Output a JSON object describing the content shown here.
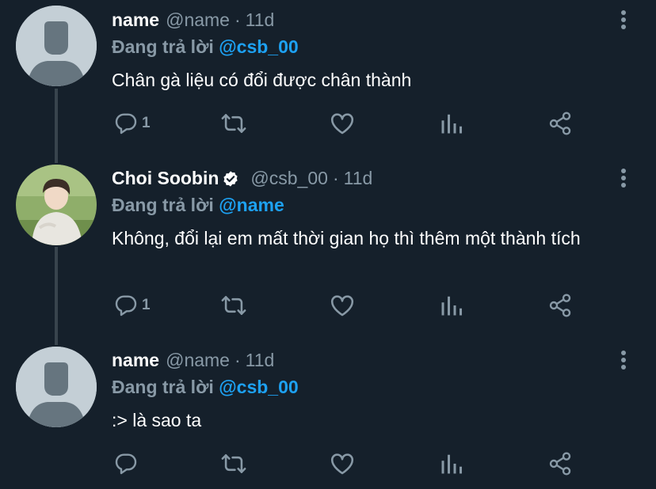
{
  "tweets": [
    {
      "display_name": "name",
      "handle": "@name",
      "separator": "·",
      "time": "11d",
      "reply_prefix": "Đang trả lời",
      "reply_mention": "@csb_00",
      "text": "Chân gà liệu có đổi được chân thành",
      "reply_count": "1",
      "verified": false
    },
    {
      "display_name": "Choi Soobin",
      "handle": "@csb_00",
      "separator": "·",
      "time": "11d",
      "reply_prefix": "Đang trả lời",
      "reply_mention": "@name",
      "text": "Không, đổi lại em mất thời gian họ thì thêm một thành tích",
      "reply_count": "1",
      "verified": true
    },
    {
      "display_name": "name",
      "handle": "@name",
      "separator": "·",
      "time": "11d",
      "reply_prefix": "Đang trả lời",
      "reply_mention": "@csb_00",
      "text": ":> là sao ta",
      "reply_count": "",
      "verified": false
    }
  ],
  "colors": {
    "background": "#15202b",
    "text": "#ffffff",
    "muted": "#8899a6",
    "accent": "#1da1f2",
    "thread_line": "#38444d",
    "default_avatar": "#c4cfd6"
  },
  "icons": [
    "comment-icon",
    "retweet-icon",
    "heart-icon",
    "analytics-icon",
    "share-icon",
    "more-vertical-icon",
    "verified-badge-icon"
  ]
}
